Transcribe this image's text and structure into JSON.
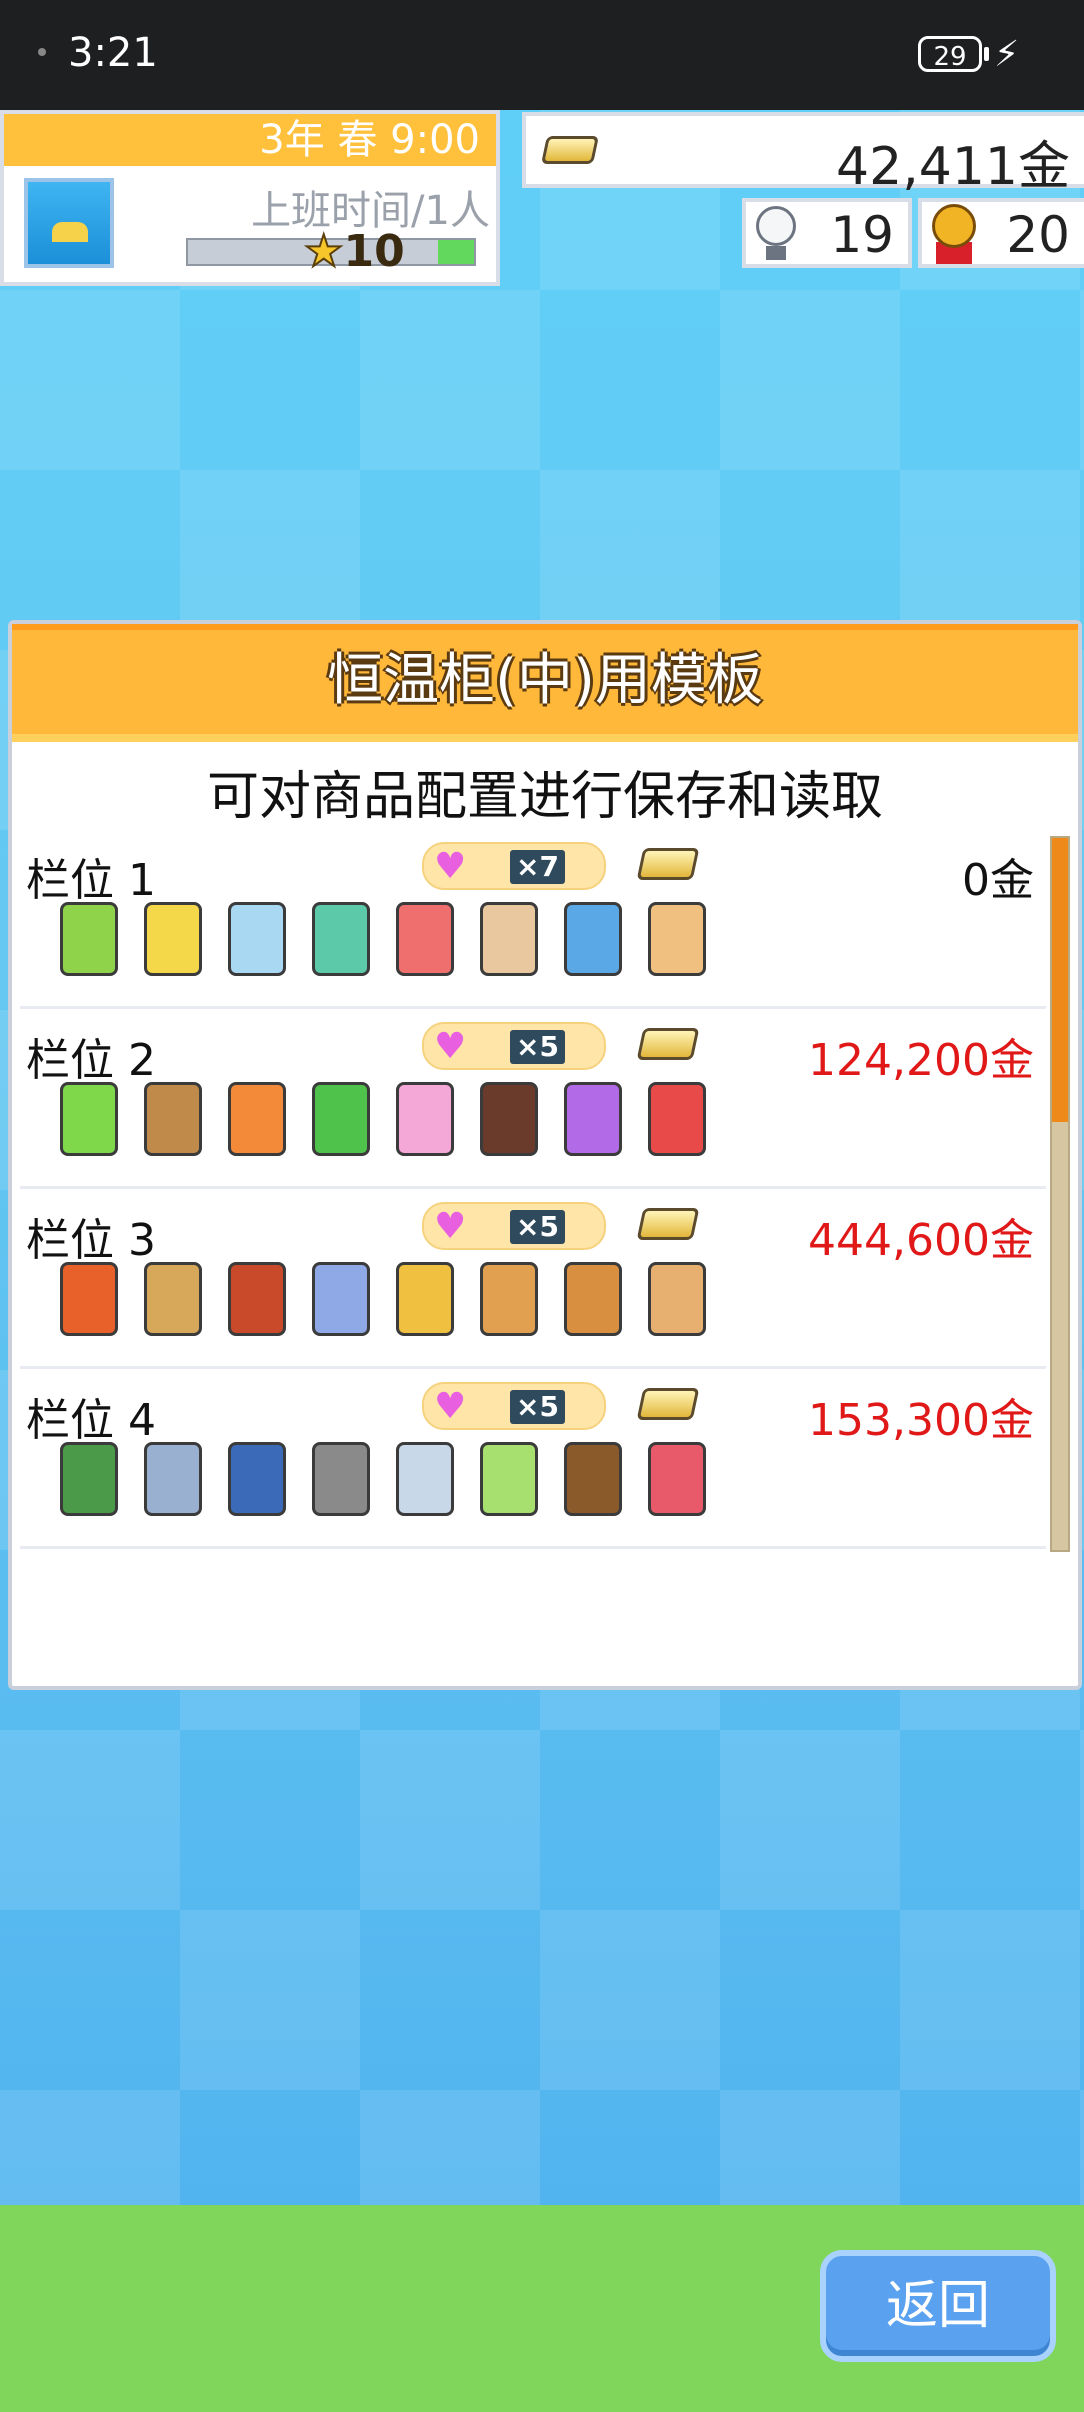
{
  "status_bar": {
    "time": "3:21",
    "battery": "29"
  },
  "hud": {
    "date": "3年 春 9:00",
    "worktime": "上班时间/1人",
    "level": "10",
    "money": "42,411金",
    "ideas": "19",
    "medals": "20"
  },
  "dialog": {
    "title": "恒温柜(中)用模板",
    "subtitle": "可对商品配置进行保存和读取",
    "slots": [
      {
        "label": "栏位 1",
        "count": "7",
        "price": "0金",
        "price_color": "#111111",
        "item_colors": [
          "#8fd34a",
          "#f5d84a",
          "#a9d8f2",
          "#5cc9a8",
          "#ef6f6f",
          "#e9c8a0",
          "#5aa8e6",
          "#f0c080"
        ]
      },
      {
        "label": "栏位 2",
        "count": "5",
        "price": "124,200金",
        "price_color": "#e01818",
        "item_colors": [
          "#7ed84a",
          "#c08a4a",
          "#f28a3a",
          "#4ec24a",
          "#f4a8d8",
          "#6a3a2a",
          "#b36ae6",
          "#e84a4a"
        ]
      },
      {
        "label": "栏位 3",
        "count": "5",
        "price": "444,600金",
        "price_color": "#e01818",
        "item_colors": [
          "#e8602a",
          "#d8a85a",
          "#c84a2a",
          "#8fa8e6",
          "#f0c040",
          "#e0a050",
          "#d89040",
          "#e8b070"
        ]
      },
      {
        "label": "栏位 4",
        "count": "5",
        "price": "153,300金",
        "price_color": "#e01818",
        "item_colors": [
          "#4a9a4a",
          "#9ab0d0",
          "#3a6ab8",
          "#8a8a8a",
          "#c8d8e8",
          "#a8e070",
          "#8a5a2a",
          "#e85a6a"
        ]
      }
    ]
  },
  "back_button": "返回"
}
